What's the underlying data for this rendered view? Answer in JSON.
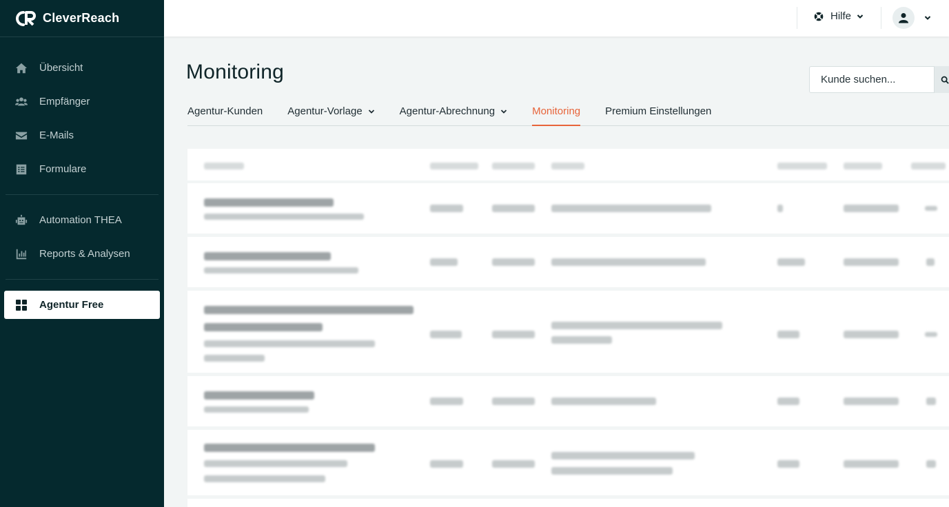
{
  "brand": {
    "name": "CleverReach"
  },
  "sidebar": {
    "items": [
      {
        "label": "Übersicht",
        "icon": "home-icon"
      },
      {
        "label": "Empfänger",
        "icon": "users-icon"
      },
      {
        "label": "E-Mails",
        "icon": "envelope-icon"
      },
      {
        "label": "Formulare",
        "icon": "form-icon"
      }
    ],
    "items2": [
      {
        "label": "Automation THEA",
        "icon": "robot-icon"
      },
      {
        "label": "Reports & Analysen",
        "icon": "chart-icon"
      }
    ],
    "active": {
      "label": "Agentur Free",
      "icon": "grid-icon"
    }
  },
  "topbar": {
    "help_label": "Hilfe"
  },
  "page": {
    "title": "Monitoring"
  },
  "search": {
    "placeholder": "Kunde suchen..."
  },
  "tabs": [
    {
      "label": "Agentur-Kunden",
      "has_dropdown": false,
      "active": false
    },
    {
      "label": "Agentur-Vorlage",
      "has_dropdown": true,
      "active": false
    },
    {
      "label": "Agentur-Abrechnung",
      "has_dropdown": true,
      "active": false
    },
    {
      "label": "Monitoring",
      "has_dropdown": false,
      "active": true
    },
    {
      "label": "Premium Einstellungen",
      "has_dropdown": false,
      "active": false
    }
  ],
  "colors": {
    "sidebar_bg": "#05292e",
    "accent": "#e7643a",
    "page_bg": "#f2f5f5"
  },
  "table": {
    "content": "blurred",
    "row_count": 5
  }
}
